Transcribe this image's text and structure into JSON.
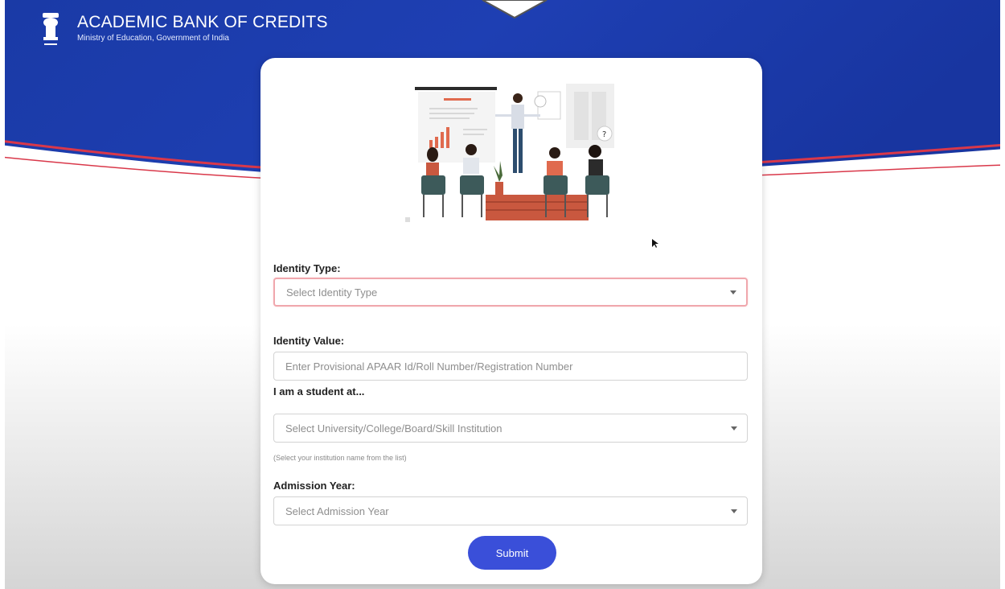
{
  "header": {
    "title": "ACADEMIC BANK OF CREDITS",
    "subtitle": "Ministry of Education, Government of India",
    "logo_icon": "national-emblem-icon"
  },
  "form": {
    "identity_type": {
      "label": "Identity Type:",
      "placeholder": "Select Identity Type"
    },
    "identity_value": {
      "label": "Identity Value:",
      "placeholder": "Enter Provisional APAAR Id/Roll Number/Registration Number"
    },
    "institution": {
      "label": "I am a student at...",
      "placeholder": "Select University/College/Board/Skill Institution",
      "hint": "(Select your institution name from the list)"
    },
    "admission_year": {
      "label": "Admission Year:",
      "placeholder": "Select Admission Year"
    },
    "submit_label": "Submit"
  },
  "colors": {
    "header_blue": "#1a3aa6",
    "accent_red": "#d9384a",
    "submit_blue": "#3a4fd9",
    "error_border": "#f0a7ad"
  }
}
